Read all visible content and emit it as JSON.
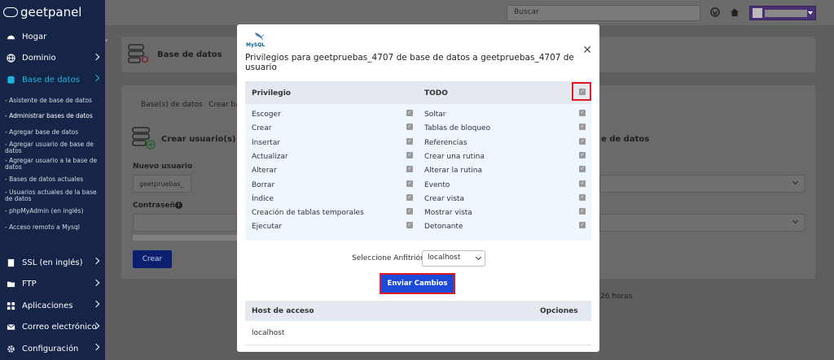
{
  "app": {
    "logo_text": "geetpanel"
  },
  "sidebar": {
    "items": [
      {
        "label": "Hogar",
        "icon": "dashboard-icon"
      },
      {
        "label": "Dominio",
        "icon": "globe-icon"
      },
      {
        "label": "Base de datos",
        "icon": "database-icon"
      },
      {
        "label": "SSL (en inglés)",
        "icon": "document-icon"
      },
      {
        "label": "FTP",
        "icon": "folder-icon"
      },
      {
        "label": "Aplicaciones",
        "icon": "grid-icon"
      },
      {
        "label": "Correo electrónico",
        "icon": "mail-icon"
      },
      {
        "label": "Configuración",
        "icon": "gear-icon"
      }
    ],
    "subitems": [
      "- Asistente de base de datos",
      "- Administrar bases de datos",
      "- Agregar base de datos",
      "- Agregar usuario de base de datos",
      "- Agregar usuario a la base de datos",
      "- Bases de datos actuales",
      "- Usuarios actuales de la base de datos",
      "- phpMyAdmin (en inglés)",
      "- Acceso remoto a Mysql"
    ]
  },
  "topbar": {
    "search_placeholder": "Buscar"
  },
  "background": {
    "page_title": "Base de datos",
    "tab1": "Base(s) de datos",
    "tab2": "Crear ba",
    "section_title": "Crear usuario(s) de",
    "section_title_right": "e de datos",
    "new_user_label": "Nuevo usuario",
    "new_user_prefix": "geetpruebas_",
    "password_label": "Contraseña",
    "create_button": "Crear",
    "note_fragment": "26 horas."
  },
  "modal": {
    "logo_text": "MySQL",
    "title": "Privilegios para geetpruebas_4707 de base de datos a geetpruebas_4707 de usuario",
    "header_privilege": "Privilegio",
    "header_all": "TODO",
    "left_privileges": [
      "Escoger",
      "Crear",
      "Insertar",
      "Actualizar",
      "Alterar",
      "Borrar",
      "Índice",
      "Creación de tablas temporales",
      "Ejecutar"
    ],
    "right_privileges": [
      "Soltar",
      "Tablas de bloqueo",
      "Referencias",
      "Crear una rutina",
      "Alterar la rutina",
      "Evento",
      "Crear vista",
      "Mostrar vista",
      "Detonante"
    ],
    "host_label": "Seleccione Anfitrión",
    "host_value": "localhost",
    "submit_button": "Enviar Cambios",
    "hosts_header_access": "Host de acceso",
    "hosts_header_options": "Opciones",
    "hosts": [
      "localhost"
    ]
  }
}
